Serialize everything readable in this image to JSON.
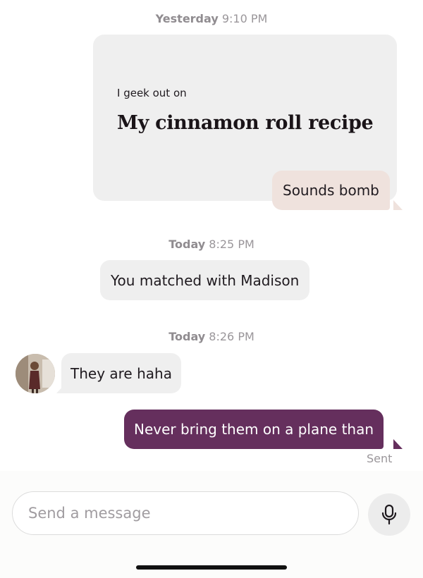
{
  "thread": {
    "header_stamp": {
      "day": "Yesterday",
      "time": "9:10 PM"
    },
    "prompt_card": {
      "label": "I geek out on",
      "answer": "My cinnamon roll recipe"
    },
    "prompt_reply": "Sounds bomb",
    "match_stamp": {
      "day": "Today",
      "time": "8:25 PM"
    },
    "match_notice": "You matched with Madison",
    "message_stamp": {
      "day": "Today",
      "time": "8:26 PM"
    },
    "incoming_message": "They are haha",
    "outgoing_message": "Never bring them on a plane than",
    "sent_status": "Sent"
  },
  "composer": {
    "placeholder": "Send a message",
    "value": "",
    "mic_icon": "microphone-icon"
  },
  "colors": {
    "outgoing_bubble": "#652f5d",
    "reply_bubble": "#efe2dd",
    "incoming_bubble": "#efefef"
  }
}
